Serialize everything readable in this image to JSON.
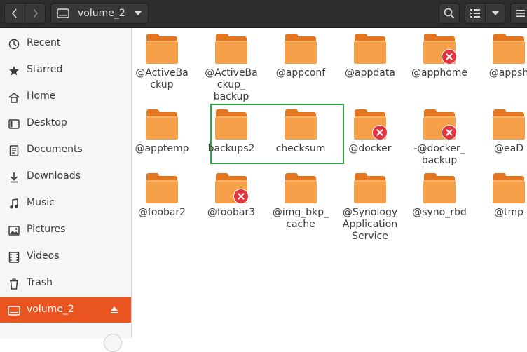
{
  "header": {
    "location": "volume_2",
    "icons": {
      "back": "chevron-left-icon",
      "forward": "chevron-right-icon",
      "drive": "drive-icon",
      "search": "search-icon",
      "view": "list-view-icon",
      "menu": "hamburger-menu-icon"
    }
  },
  "sidebar": {
    "items": [
      {
        "label": "Recent",
        "icon": "clock-icon"
      },
      {
        "label": "Starred",
        "icon": "star-icon"
      },
      {
        "label": "Home",
        "icon": "home-icon"
      },
      {
        "label": "Desktop",
        "icon": "desktop-icon"
      },
      {
        "label": "Documents",
        "icon": "document-icon"
      },
      {
        "label": "Downloads",
        "icon": "download-icon"
      },
      {
        "label": "Music",
        "icon": "music-icon"
      },
      {
        "label": "Pictures",
        "icon": "picture-icon"
      },
      {
        "label": "Videos",
        "icon": "video-icon"
      },
      {
        "label": "Trash",
        "icon": "trash-icon"
      },
      {
        "label": "volume_2",
        "icon": "drive-icon",
        "active": true
      }
    ],
    "accent": "#e95420"
  },
  "files": [
    {
      "name": "@ActiveBackup",
      "label": "@ActiveBa\nckup",
      "locked": false
    },
    {
      "name": "@ActiveBackup_backup",
      "label": "@ActiveBa\nckup_\nbackup",
      "locked": false
    },
    {
      "name": "@appconf",
      "label": "@appconf",
      "locked": false
    },
    {
      "name": "@appdata",
      "label": "@appdata",
      "locked": false
    },
    {
      "name": "@apphome",
      "label": "@apphome",
      "locked": true
    },
    {
      "name": "@appshare",
      "label": "@appsh",
      "locked": false
    },
    {
      "name": "@apptemp",
      "label": "@apptemp",
      "locked": false
    },
    {
      "name": "backups2",
      "label": "backups2",
      "locked": false
    },
    {
      "name": "checksum",
      "label": "checksum",
      "locked": false
    },
    {
      "name": "@docker",
      "label": "@docker",
      "locked": true
    },
    {
      "name": "-@docker_backup",
      "label": "-@docker_\nbackup",
      "locked": true
    },
    {
      "name": "@eaDir",
      "label": "@eaD",
      "locked": false
    },
    {
      "name": "@foobar2",
      "label": "@foobar2",
      "locked": false
    },
    {
      "name": "@foobar3",
      "label": "@foobar3",
      "locked": true
    },
    {
      "name": "@img_bkp_cache",
      "label": "@img_bkp_\ncache",
      "locked": false
    },
    {
      "name": "@SynologyApplicationService",
      "label": "@Synology\nApplication\nService",
      "locked": false
    },
    {
      "name": "@syno_rbd",
      "label": "@syno_rbd",
      "locked": false
    },
    {
      "name": "@tmp",
      "label": "@tmp",
      "locked": false
    }
  ],
  "colors": {
    "folder_front": "#f6a04a",
    "folder_back": "#e3761e",
    "locked_badge": "#e0343f",
    "selection_box": "#2eaa45"
  }
}
